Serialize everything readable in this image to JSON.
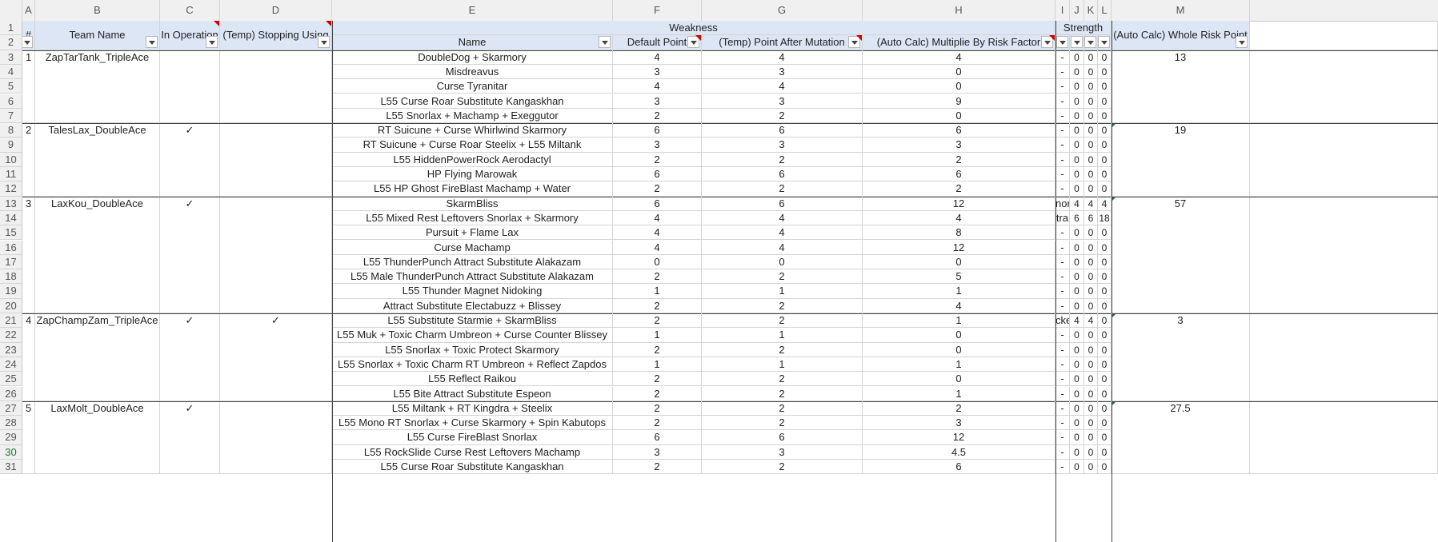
{
  "columns": [
    "A",
    "B",
    "C",
    "D",
    "E",
    "F",
    "G",
    "H",
    "I",
    "J",
    "K",
    "L",
    "M"
  ],
  "header": {
    "index": "#",
    "team_name": "Team Name",
    "in_operation": "In Operation",
    "temp_stopping": "(Temp) Stopping Using",
    "weakness": "Weakness",
    "name": "Name",
    "default_point": "Default Point",
    "point_after_mutation": "(Temp) Point After Mutation",
    "auto_multiplier": "(Auto Calc) Multiplie By Risk Factor",
    "strength": "Strength",
    "whole_risk": "(Auto Calc) Whole Risk Point"
  },
  "teams": [
    {
      "no": "1",
      "name": "ZapTarTank_TripleAce",
      "op": "",
      "stop": "",
      "risk": "13"
    },
    {
      "no": "2",
      "name": "TalesLax_DoubleAce",
      "op": "✓",
      "stop": "",
      "risk": "19"
    },
    {
      "no": "3",
      "name": "LaxKou_DoubleAce",
      "op": "✓",
      "stop": "",
      "risk": "57"
    },
    {
      "no": "4",
      "name": "ZapChampZam_TripleAce",
      "op": "✓",
      "stop": "✓",
      "risk": "3"
    },
    {
      "no": "5",
      "name": "LaxMolt_DoubleAce",
      "op": "✓",
      "stop": "",
      "risk": "27.5"
    }
  ],
  "rows": [
    {
      "r": "3",
      "name": "DoubleDog + Skarmory",
      "f": "4",
      "g": "4",
      "h": "4",
      "i": "-",
      "j": "0",
      "k": "0",
      "l": "0"
    },
    {
      "r": "4",
      "name": "Misdreavus",
      "f": "3",
      "g": "3",
      "h": "0",
      "i": "-",
      "j": "0",
      "k": "0",
      "l": "0"
    },
    {
      "r": "5",
      "name": "Curse Tyranitar",
      "f": "4",
      "g": "4",
      "h": "0",
      "i": "-",
      "j": "0",
      "k": "0",
      "l": "0"
    },
    {
      "r": "6",
      "name": "L55 Curse Roar Substitute Kangaskhan",
      "f": "3",
      "g": "3",
      "h": "9",
      "i": "-",
      "j": "0",
      "k": "0",
      "l": "0"
    },
    {
      "r": "7",
      "name": "L55 Snorlax + Machamp + Exeggutor",
      "f": "2",
      "g": "2",
      "h": "0",
      "i": "-",
      "j": "0",
      "k": "0",
      "l": "0"
    },
    {
      "r": "8",
      "name": "RT Suicune + Curse Whirlwind Skarmory",
      "f": "6",
      "g": "6",
      "h": "6",
      "i": "-",
      "j": "0",
      "k": "0",
      "l": "0"
    },
    {
      "r": "9",
      "name": "RT Suicune + Curse Roar Steelix + L55 Miltank",
      "f": "3",
      "g": "3",
      "h": "3",
      "i": "-",
      "j": "0",
      "k": "0",
      "l": "0"
    },
    {
      "r": "10",
      "name": "L55 HiddenPowerRock Aerodactyl",
      "f": "2",
      "g": "2",
      "h": "2",
      "i": "-",
      "j": "0",
      "k": "0",
      "l": "0"
    },
    {
      "r": "11",
      "name": "HP Flying Marowak",
      "f": "6",
      "g": "6",
      "h": "6",
      "i": "-",
      "j": "0",
      "k": "0",
      "l": "0"
    },
    {
      "r": "12",
      "name": "L55 HP Ghost FireBlast Machamp + Water",
      "f": "2",
      "g": "2",
      "h": "2",
      "i": "-",
      "j": "0",
      "k": "0",
      "l": "0"
    },
    {
      "r": "13",
      "name": "SkarmBliss",
      "f": "6",
      "g": "6",
      "h": "12",
      "i": "nor",
      "j": "4",
      "k": "4",
      "l": "4"
    },
    {
      "r": "14",
      "name": "L55 Mixed Rest Leftovers Snorlax + Skarmory",
      "f": "4",
      "g": "4",
      "h": "4",
      "i": "tra",
      "j": "6",
      "k": "6",
      "l": "18"
    },
    {
      "r": "15",
      "name": "Pursuit + Flame Lax",
      "f": "4",
      "g": "4",
      "h": "8",
      "i": "-",
      "j": "0",
      "k": "0",
      "l": "0"
    },
    {
      "r": "16",
      "name": "Curse Machamp",
      "f": "4",
      "g": "4",
      "h": "12",
      "i": "-",
      "j": "0",
      "k": "0",
      "l": "0"
    },
    {
      "r": "17",
      "name": "L55 ThunderPunch Attract Substitute Alakazam",
      "f": "0",
      "g": "0",
      "h": "0",
      "i": "-",
      "j": "0",
      "k": "0",
      "l": "0"
    },
    {
      "r": "18",
      "name": "L55 Male ThunderPunch Attract Substitute Alakazam",
      "f": "2",
      "g": "2",
      "h": "5",
      "i": "-",
      "j": "0",
      "k": "0",
      "l": "0"
    },
    {
      "r": "19",
      "name": "L55 Thunder Magnet Nidoking",
      "f": "1",
      "g": "1",
      "h": "1",
      "i": "-",
      "j": "0",
      "k": "0",
      "l": "0"
    },
    {
      "r": "20",
      "name": "Attract Substitute Electabuzz + Blissey",
      "f": "2",
      "g": "2",
      "h": "4",
      "i": "-",
      "j": "0",
      "k": "0",
      "l": "0"
    },
    {
      "r": "21",
      "name": "L55 Substitute Starmie + SkarmBliss",
      "f": "2",
      "g": "2",
      "h": "1",
      "i": "cke",
      "j": "4",
      "k": "4",
      "l": "0"
    },
    {
      "r": "22",
      "name": "L55 Muk + Toxic Charm Umbreon + Curse Counter Blissey",
      "f": "1",
      "g": "1",
      "h": "0",
      "i": "-",
      "j": "0",
      "k": "0",
      "l": "0"
    },
    {
      "r": "23",
      "name": "L55 Snorlax + Toxic Protect Skarmory",
      "f": "2",
      "g": "2",
      "h": "0",
      "i": "-",
      "j": "0",
      "k": "0",
      "l": "0"
    },
    {
      "r": "24",
      "name": "L55 Snorlax + Toxic Charm RT Umbreon + Reflect Zapdos",
      "f": "1",
      "g": "1",
      "h": "1",
      "i": "-",
      "j": "0",
      "k": "0",
      "l": "0"
    },
    {
      "r": "25",
      "name": "L55 Reflect Raikou",
      "f": "2",
      "g": "2",
      "h": "0",
      "i": "-",
      "j": "0",
      "k": "0",
      "l": "0"
    },
    {
      "r": "26",
      "name": "L55 Bite Attract Substitute Espeon",
      "f": "2",
      "g": "2",
      "h": "1",
      "i": "-",
      "j": "0",
      "k": "0",
      "l": "0"
    },
    {
      "r": "27",
      "name": "L55 Miltank + RT Kingdra + Steelix",
      "f": "2",
      "g": "2",
      "h": "2",
      "i": "-",
      "j": "0",
      "k": "0",
      "l": "0"
    },
    {
      "r": "28",
      "name": "L55 Mono RT Snorlax + Curse Skarmory + Spin Kabutops",
      "f": "2",
      "g": "2",
      "h": "3",
      "i": "-",
      "j": "0",
      "k": "0",
      "l": "0"
    },
    {
      "r": "29",
      "name": "L55 Curse FireBlast Snorlax",
      "f": "6",
      "g": "6",
      "h": "12",
      "i": "-",
      "j": "0",
      "k": "0",
      "l": "0"
    },
    {
      "r": "30",
      "name": "L55 RockSlide Curse Rest Leftovers Machamp",
      "f": "3",
      "g": "3",
      "h": "4.5",
      "i": "-",
      "j": "0",
      "k": "0",
      "l": "0"
    },
    {
      "r": "31",
      "name": "L55 Curse Roar Substitute Kangaskhan",
      "f": "2",
      "g": "2",
      "h": "6",
      "i": "-",
      "j": "0",
      "k": "0",
      "l": "0"
    }
  ],
  "header_row_numbers": [
    "1",
    "2"
  ],
  "selected_row": "30",
  "colors": {
    "header_bg": "#dce6f5",
    "grid": "#d4d4d4",
    "comment_marker": "#d00000",
    "selected_row": "#1b7a3b"
  }
}
